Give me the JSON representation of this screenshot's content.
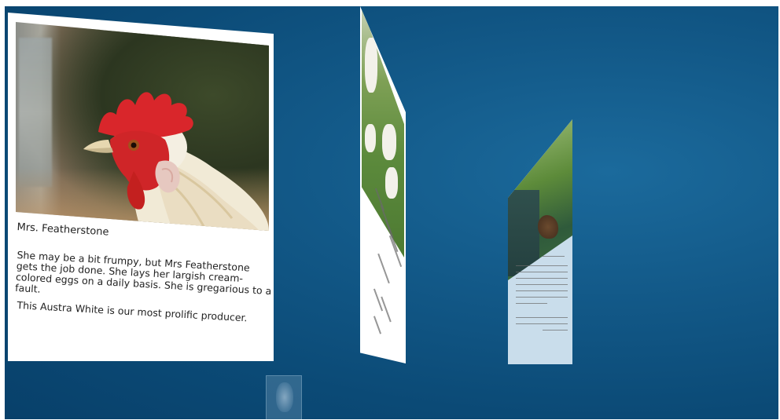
{
  "cards": [
    {
      "name": "Mrs. Featherstone",
      "description": "She may be a bit frumpy, but Mrs Featherstone gets the job done. She lays her largish cream-colored eggs on a daily basis. She is gregarious to a fault.",
      "note": "This Austra White is our most prolific producer.",
      "image_icon": "rooster-photo"
    },
    {
      "image_icon": "white-hens-photo"
    },
    {
      "image_icon": "hen-coop-photo"
    }
  ],
  "colors": {
    "background": "#0f5585",
    "card": "#ffffff",
    "right_card_text_panel": "#c9ddeb"
  }
}
